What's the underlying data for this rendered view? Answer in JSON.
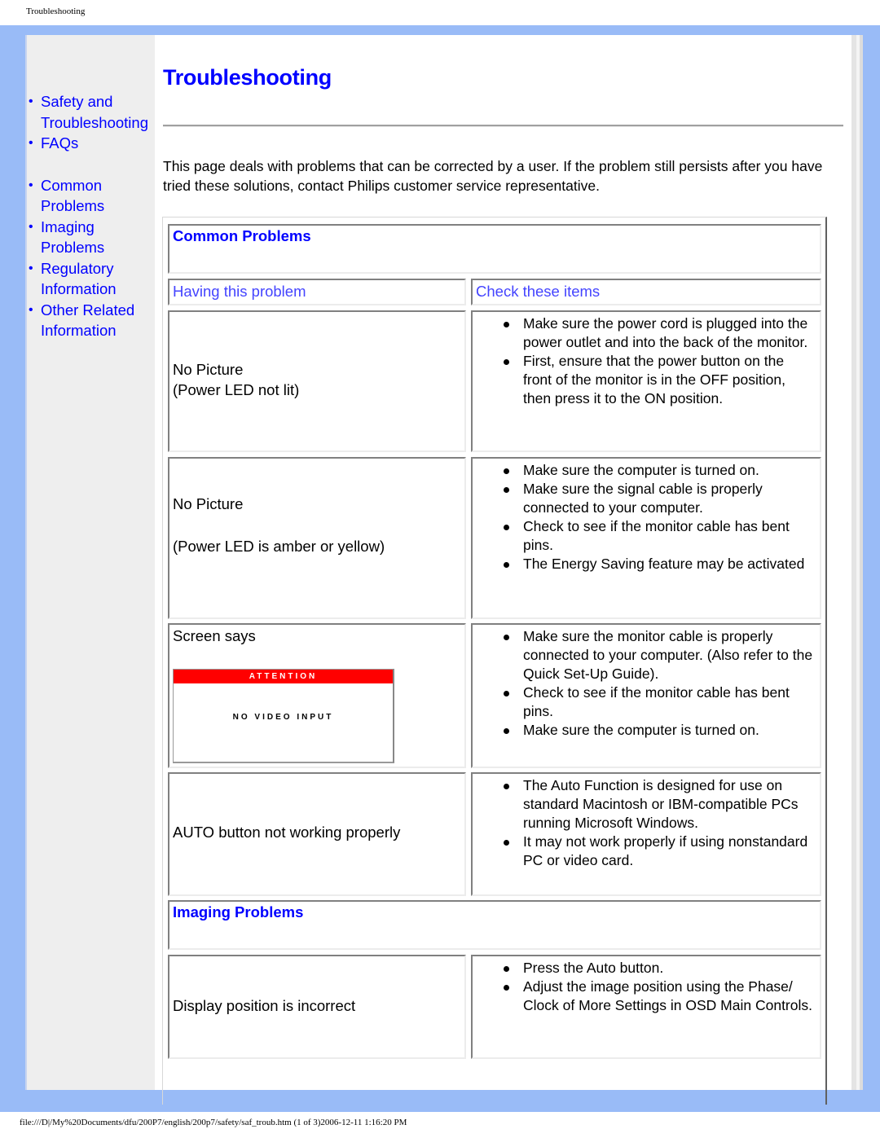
{
  "print_header": "Troubleshooting",
  "print_footer": "file:///D|/My%20Documents/dfu/200P7/english/200p7/safety/saf_troub.htm (1 of 3)2006-12-11 1:16:20 PM",
  "sidebar": {
    "bullet": "•",
    "items": [
      {
        "label_line1": "Safety and",
        "label_line2": "Troubleshooting"
      },
      {
        "label_line1": "FAQs"
      },
      {
        "label_line1": "Common",
        "label_line2": "Problems"
      },
      {
        "label_line1": "Imaging",
        "label_line2": "Problems"
      },
      {
        "label_line1": "Regulatory",
        "label_line2": "Information"
      },
      {
        "label_line1": "Other Related",
        "label_line2": "Information"
      }
    ]
  },
  "page": {
    "title": "Troubleshooting",
    "intro": "This page deals with problems that can be corrected by a user. If the problem still persists after you have tried these solutions, contact Philips customer service representative."
  },
  "common_problems": {
    "title": "Common Problems",
    "col_problem": "Having this problem",
    "col_check": "Check these items",
    "rows": [
      {
        "problem_line1": "No Picture",
        "problem_line2": "(Power LED not lit)",
        "checks": [
          "Make sure the power cord is plugged into the power outlet and into the back of the monitor.",
          "First, ensure that the power button on the front of the monitor is in the OFF position, then press it to the ON position."
        ]
      },
      {
        "problem_line1": "No Picture",
        "problem_line2": "(Power LED is amber or yellow)",
        "checks": [
          "Make sure the computer is turned on.",
          "Make sure the signal cable is properly connected to your computer.",
          "Check to see if the monitor cable has bent pins.",
          "The Energy Saving feature may be activated"
        ]
      },
      {
        "problem_line1": "Screen says",
        "osd_header": "ATTENTION",
        "osd_message": "NO VIDEO INPUT",
        "osd_color": "#ff0000",
        "checks": [
          "Make sure the monitor cable is properly connected to your computer. (Also refer to the Quick Set-Up Guide).",
          "Check to see if the monitor cable has bent pins.",
          "Make sure the computer is turned on."
        ]
      },
      {
        "problem_line1": "AUTO button not working properly",
        "checks": [
          "The Auto Function is designed for use on standard Macintosh or IBM-compatible PCs running Microsoft Windows.",
          "It may not work properly if using nonstandard PC or video card."
        ]
      }
    ]
  },
  "imaging_problems": {
    "title": "Imaging Problems",
    "rows": [
      {
        "problem_line1": "Display position is incorrect",
        "checks": [
          "Press the Auto button.",
          "Adjust the image position using the Phase/ Clock of More Settings in OSD Main Controls."
        ]
      }
    ]
  },
  "colors": {
    "frame": "#99bbf7",
    "link": "#0000ff",
    "sidebar_bg": "#eeeeee"
  }
}
